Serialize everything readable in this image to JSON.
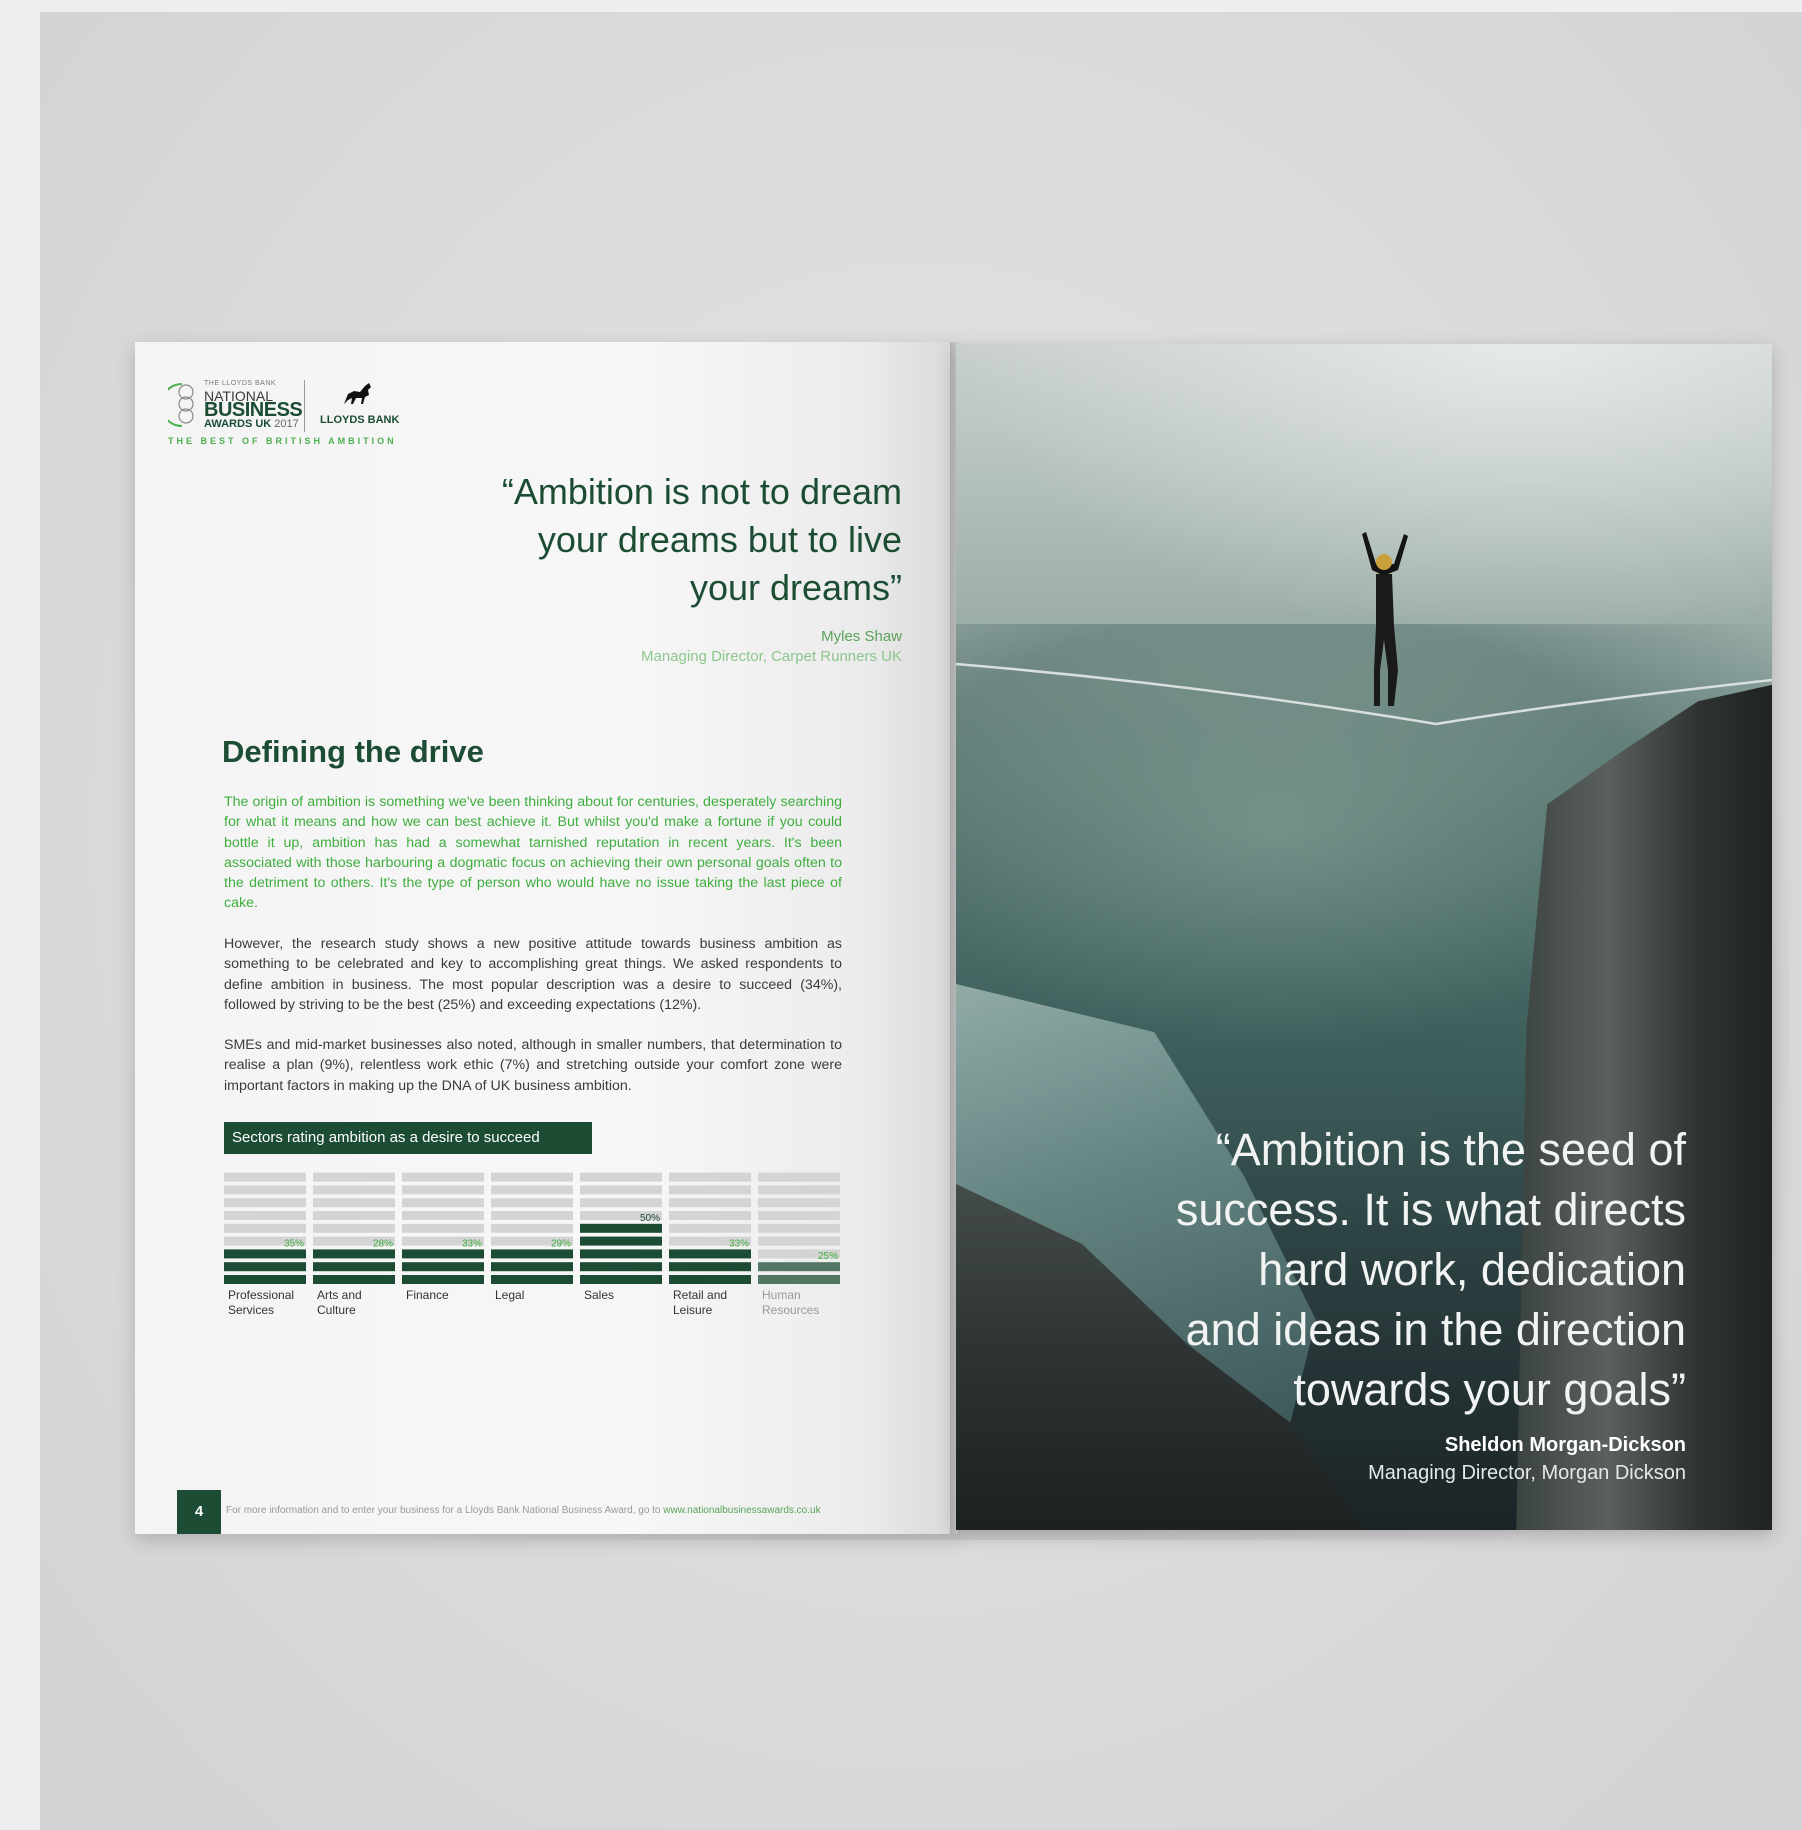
{
  "logo": {
    "small_text": "THE LLOYDS BANK",
    "line1": "NATIONAL",
    "line2": "BUSINESS",
    "line3": "AWARDS UK",
    "year": "2017",
    "bank": "LLOYDS BANK",
    "tagline": "THE BEST OF BRITISH AMBITION"
  },
  "left_quote": {
    "lines": [
      "“Ambition is not to dream",
      "your dreams but to live",
      "your dreams”"
    ],
    "author": "Myles Shaw",
    "role": "Managing Director, Carpet Runners UK"
  },
  "section": {
    "heading": "Defining the drive",
    "para1": "The origin of ambition is something we've been thinking about for centuries, desperately searching for what it means and how we can best achieve it. But whilst you'd make a fortune if you could bottle it up, ambition has had a somewhat tarnished reputation in recent years. It's been associated with those harbouring a dogmatic focus on achieving their own personal goals often to the detriment to others. It's the type of person who would have no issue taking the last piece of cake.",
    "para2": "However, the research study shows a new positive attitude towards business ambition as something to be celebrated and key to accomplishing great things. We asked respondents to define ambition in business. The most popular description was a desire to succeed (34%), followed by striving to be the best (25%) and exceeding expectations (12%).",
    "para3": "SMEs and mid-market businesses also noted, although in smaller numbers, that determination to realise a plan (9%), relentless work ethic (7%) and stretching outside your comfort zone were important factors in making up the DNA of UK business ambition."
  },
  "chart_data": {
    "type": "bar",
    "title": "Sectors rating ambition as a desire to succeed",
    "categories": [
      "Professional Services",
      "Arts and Culture",
      "Finance",
      "Legal",
      "Sales",
      "Retail and Leisure",
      "Human Resources"
    ],
    "category_lines": [
      [
        "Professional",
        "Services"
      ],
      [
        "Arts and",
        "Culture"
      ],
      [
        "Finance"
      ],
      [
        "Legal"
      ],
      [
        "Sales"
      ],
      [
        "Retail and",
        "Leisure"
      ],
      [
        "Human",
        "Resources"
      ]
    ],
    "values": [
      35,
      28,
      33,
      29,
      50,
      33,
      25
    ],
    "value_labels": [
      "35%",
      "28%",
      "33%",
      "29%",
      "50%",
      "33%",
      "25%"
    ],
    "ylim": [
      0,
      100
    ],
    "colors": {
      "fill": "#1c4d34",
      "track": "#d4d4d4",
      "label": "#3fae3f"
    }
  },
  "footer": {
    "page_number": "4",
    "text": "For more information and to enter your business for a Lloyds Bank National Business Award, go to ",
    "link": "www.nationalbusinessawards.co.uk"
  },
  "right_quote": {
    "lines": [
      "“Ambition is the seed of",
      "success. It is what directs",
      "hard work, dedication",
      "and ideas in the direction",
      "towards your goals”"
    ],
    "author": "Sheldon Morgan-Dickson",
    "role": "Managing Director, Morgan Dickson"
  }
}
